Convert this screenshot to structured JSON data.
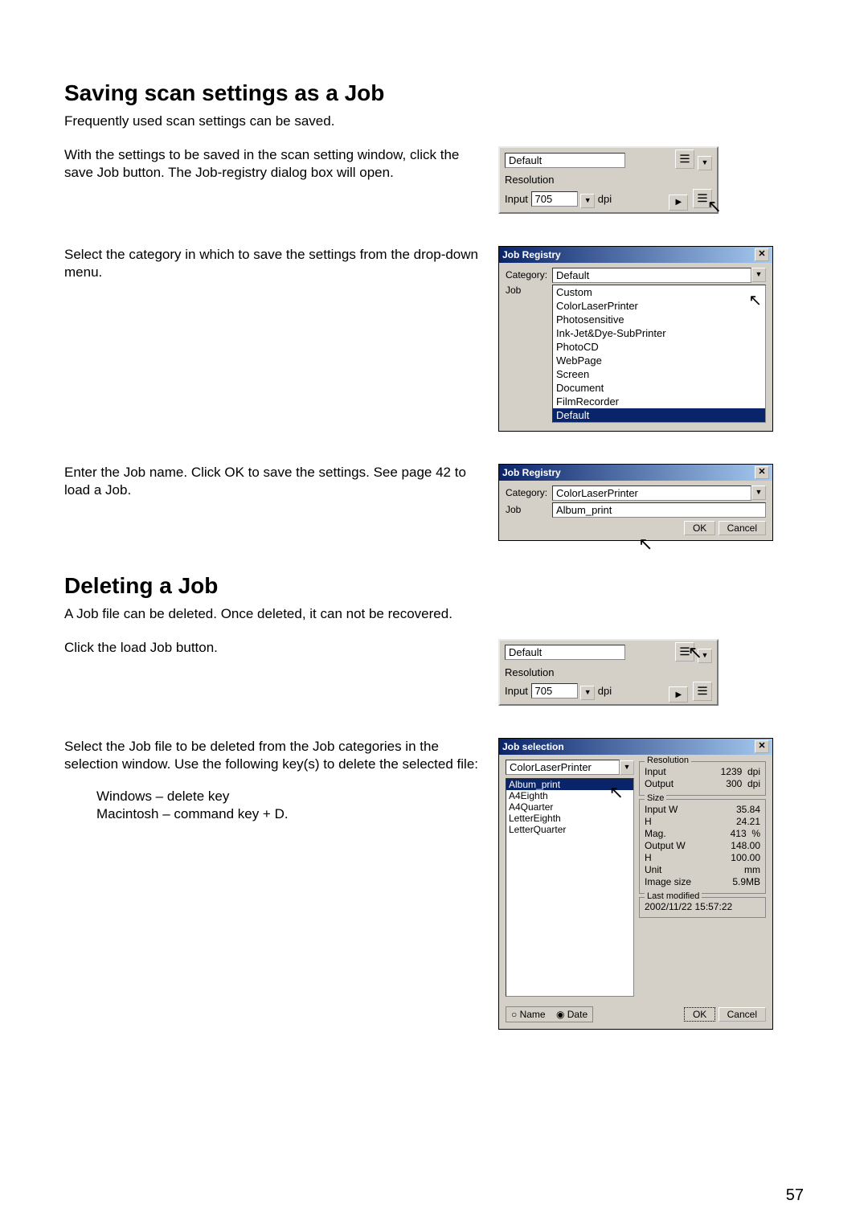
{
  "section1": {
    "heading": "Saving scan settings as a Job",
    "intro": "Frequently used scan settings can be saved.",
    "step1": "With the settings to be saved in the scan setting window, click the save Job button. The Job-registry dialog box will open.",
    "step2": "Select the category in which to save the settings from the drop-down menu.",
    "step3": "Enter the Job name. Click OK to save the settings. See page 42 to load a Job."
  },
  "panel1": {
    "title": "Default",
    "resLabel": "Resolution",
    "inputLabel": "Input",
    "inputVal": "705",
    "unit": "dpi"
  },
  "jobreg1": {
    "title": "Job Registry",
    "catLabel": "Category:",
    "jobLabel": "Job",
    "catSelected": "Default",
    "options": [
      "Custom",
      "ColorLaserPrinter",
      "Photosensitive",
      "Ink-Jet&Dye-SubPrinter",
      "PhotoCD",
      "WebPage",
      "Screen",
      "Document",
      "FilmRecorder",
      "Default"
    ]
  },
  "jobreg2": {
    "title": "Job Registry",
    "catLabel": "Category:",
    "jobLabel": "Job",
    "catVal": "ColorLaserPrinter",
    "jobVal": "Album_print",
    "ok": "OK",
    "cancel": "Cancel"
  },
  "section2": {
    "heading": "Deleting a Job",
    "intro": "A Job file can be deleted. Once deleted, it can not be recovered.",
    "step1": "Click the load Job button.",
    "step2": "Select the Job file to be deleted from the Job categories in the selection window. Use the following key(s) to delete the selected file:",
    "keysWin": "Windows – delete key",
    "keysMac": "Macintosh – command key + D."
  },
  "panel2": {
    "title": "Default",
    "resLabel": "Resolution",
    "inputLabel": "Input",
    "inputVal": "705",
    "unit": "dpi"
  },
  "jobsel": {
    "title": "Job selection",
    "catVal": "ColorLaserPrinter",
    "list": [
      "Album_print",
      "A4Eighth",
      "A4Quarter",
      "LetterEighth",
      "LetterQuarter"
    ],
    "resGroup": "Resolution",
    "resInputLbl": "Input",
    "resInputVal": "1239",
    "resOutputLbl": "Output",
    "resOutputVal": "300",
    "resUnit": "dpi",
    "sizeGroup": "Size",
    "sizeInputWLbl": "Input W",
    "sizeInputWVal": "35.84",
    "sizeHLbl": "H",
    "sizeH1Val": "24.21",
    "magLbl": "Mag.",
    "magVal": "413",
    "magUnit": "%",
    "outWLbl": "Output W",
    "outWVal": "148.00",
    "sizeH2Val": "100.00",
    "unitLbl": "Unit",
    "unitVal": "mm",
    "imgSizeLbl": "Image size",
    "imgSizeVal": "5.9MB",
    "lastModGroup": "Last modified",
    "lastModVal": "2002/11/22  15:57:22",
    "sortName": "Name",
    "sortDate": "Date",
    "ok": "OK",
    "cancel": "Cancel"
  },
  "pageNumber": "57"
}
